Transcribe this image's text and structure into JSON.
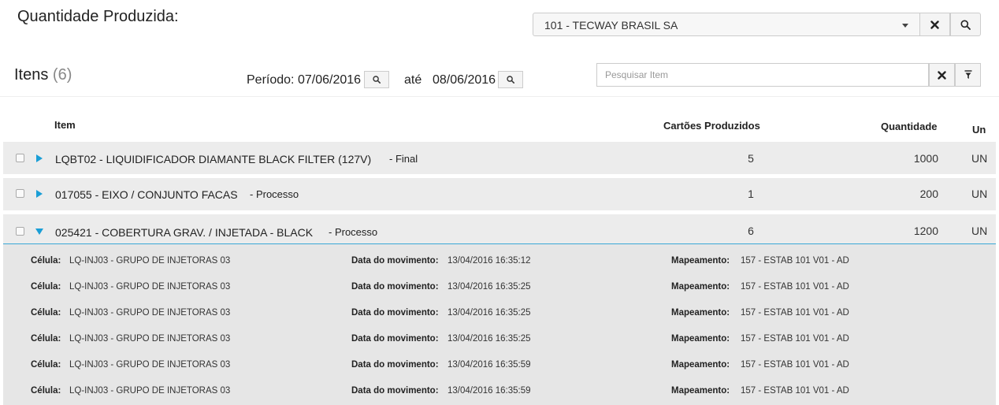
{
  "header": {
    "title": "Quantidade Produzida:",
    "company": "101 - TECWAY BRASIL SA"
  },
  "items_header": {
    "title": "Itens",
    "count": "(6)",
    "period_label": "Período:",
    "period_from": "07/06/2016",
    "until_label": "até",
    "period_to": "08/06/2016",
    "search_placeholder": "Pesquisar Item"
  },
  "columns": {
    "item": "Item",
    "cards": "Cartões Produzidos",
    "qty": "Quantidade",
    "un": "Un"
  },
  "rows": [
    {
      "label": "LQBT02 - LIQUIDIFICADOR DIAMANTE BLACK FILTER (127V)",
      "type": "- Final",
      "cards": "5",
      "qty": "1000",
      "un": "UN",
      "expanded": false
    },
    {
      "label": "017055 - EIXO / CONJUNTO FACAS",
      "type": "- Processo",
      "cards": "1",
      "qty": "200",
      "un": "UN",
      "expanded": false
    },
    {
      "label": "025421 - COBERTURA GRAV. / INJETADA - BLACK",
      "type": "- Processo",
      "cards": "6",
      "qty": "1200",
      "un": "UN",
      "expanded": true
    }
  ],
  "detail_labels": {
    "cell": "Célula:",
    "date": "Data do movimento:",
    "mapping": "Mapeamento:"
  },
  "details": [
    {
      "cell": "LQ-INJ03 - GRUPO DE INJETORAS 03",
      "date": "13/04/2016 16:35:12",
      "mapping": "157 - ESTAB 101 V01 - AD"
    },
    {
      "cell": "LQ-INJ03 - GRUPO DE INJETORAS 03",
      "date": "13/04/2016 16:35:25",
      "mapping": "157 - ESTAB 101 V01 - AD"
    },
    {
      "cell": "LQ-INJ03 - GRUPO DE INJETORAS 03",
      "date": "13/04/2016 16:35:25",
      "mapping": "157 - ESTAB 101 V01 - AD"
    },
    {
      "cell": "LQ-INJ03 - GRUPO DE INJETORAS 03",
      "date": "13/04/2016 16:35:25",
      "mapping": "157 - ESTAB 101 V01 - AD"
    },
    {
      "cell": "LQ-INJ03 - GRUPO DE INJETORAS 03",
      "date": "13/04/2016 16:35:59",
      "mapping": "157 - ESTAB 101 V01 - AD"
    },
    {
      "cell": "LQ-INJ03 - GRUPO DE INJETORAS 03",
      "date": "13/04/2016 16:35:59",
      "mapping": "157 - ESTAB 101 V01 - AD"
    }
  ],
  "icons": {
    "expand": "triangle-right-icon",
    "collapse": "triangle-down-icon",
    "clear": "close-icon",
    "search": "search-icon",
    "filter": "filter-icon"
  },
  "colors": {
    "accent": "#1a9ed6",
    "row_bg": "#ececec",
    "detail_bg": "#e6e6e6"
  }
}
